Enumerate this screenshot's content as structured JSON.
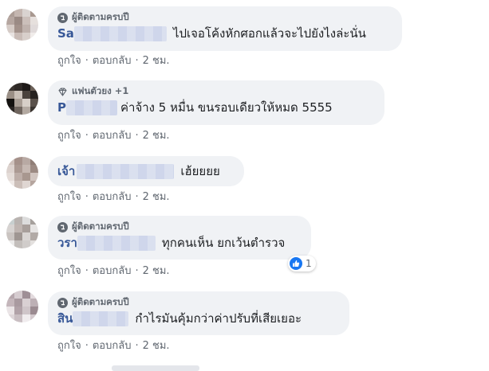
{
  "comments": [
    {
      "badge": "ผู้ติดตามครบปี",
      "name": "Sa",
      "text": "ไปเจอโค้งหักศอกแล้วจะไปยังไงล่ะนั่น",
      "like": "ถูกใจ",
      "reply": "ตอบกลับ",
      "time": "2 ชม.",
      "avatar_colors": [
        "#ac9d96",
        "#c4b6b0",
        "#d9d3d0",
        "#a89890"
      ]
    },
    {
      "badge": "แฟนตัวยง +1",
      "name": "P",
      "text": "ค่าจ้าง 5 หมื่น ขนรอบเดียวให้หมด 5555",
      "like": "ถูกใจ",
      "reply": "ตอบกลับ",
      "time": "2 ชม.",
      "avatar_colors": [
        "#2f2a27",
        "#6a5f57",
        "#9a8f86",
        "#4a423c"
      ]
    },
    {
      "badge": "",
      "name": "เจ้า",
      "text": "เฮ้ยยยย",
      "like": "ถูกใจ",
      "reply": "ตอบกลับ",
      "time": "2 ชม.",
      "avatar_colors": [
        "#cfc2bd",
        "#a5918a",
        "#b8a9a3",
        "#8f7d76"
      ]
    },
    {
      "badge": "ผู้ติดตามครบปี",
      "name": "วรา",
      "text": "ทุกคนเห็น ยกเว้นตำรวจ",
      "like": "ถูกใจ",
      "reply": "ตอบกลับ",
      "time": "2 ชม.",
      "reaction_count": "1",
      "avatar_colors": [
        "#c8cfcf",
        "#b9b3b0",
        "#dcdcdc",
        "#a6a09c"
      ]
    },
    {
      "badge": "ผู้ติดตามครบปี",
      "name": "สิน",
      "text": "กำไรมันคุ้มกว่าค่าปรับที่เสียเยอะ",
      "like": "ถูกใจ",
      "reply": "ตอบกลับ",
      "time": "2 ชม.",
      "avatar_colors": [
        "#b6a7ad",
        "#d6ccd0",
        "#9f8f96",
        "#e2dadd"
      ]
    }
  ],
  "dot": "·",
  "colors": {
    "name": "#385898",
    "bubble": "#f0f2f5",
    "meta": "#606770",
    "like_blue": "#1877f2"
  }
}
